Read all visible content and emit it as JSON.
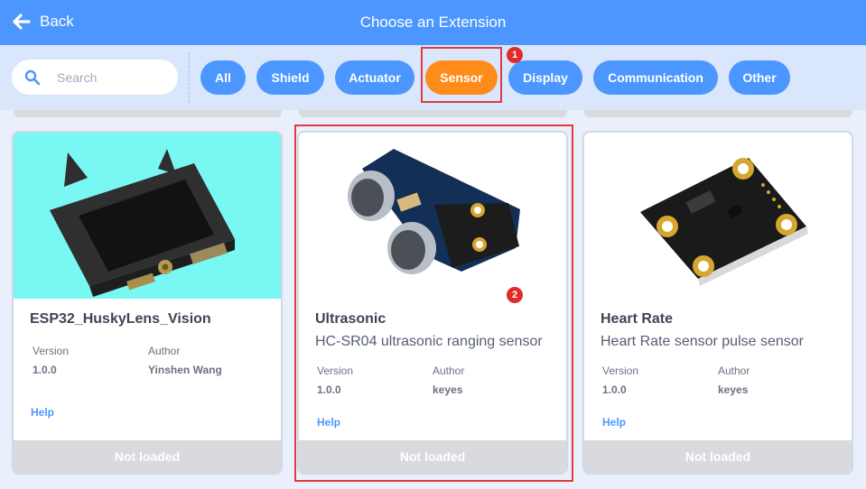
{
  "header": {
    "back_label": "Back",
    "title": "Choose an Extension"
  },
  "search": {
    "placeholder": "Search",
    "value": ""
  },
  "tags": [
    {
      "label": "All",
      "active": false
    },
    {
      "label": "Shield",
      "active": false
    },
    {
      "label": "Actuator",
      "active": false
    },
    {
      "label": "Sensor",
      "active": true
    },
    {
      "label": "Display",
      "active": false
    },
    {
      "label": "Communication",
      "active": false
    },
    {
      "label": "Other",
      "active": false
    }
  ],
  "callouts": [
    "1",
    "2"
  ],
  "meta_labels": {
    "version": "Version",
    "author": "Author",
    "help": "Help"
  },
  "cards": [
    {
      "name": "ESP32_HuskyLens_Vision",
      "description": "",
      "version": "1.0.0",
      "author": "Yinshen Wang",
      "status": "Not loaded",
      "image": "huskylens-camera-module"
    },
    {
      "name": "Ultrasonic",
      "description": "HC-SR04 ultrasonic ranging sensor",
      "version": "1.0.0",
      "author": "keyes",
      "status": "Not loaded",
      "image": "ultrasonic-sensor-module"
    },
    {
      "name": "Heart Rate",
      "description": "Heart Rate sensor pulse sensor",
      "version": "1.0.0",
      "author": "keyes",
      "status": "Not loaded",
      "image": "heart-rate-sensor-module"
    }
  ],
  "colors": {
    "header": "#4c97ff",
    "filter_bar": "#d9e6fb",
    "tag": "#4c97ff",
    "tag_active": "#ff8c1a",
    "highlight": "#e13a3a"
  }
}
